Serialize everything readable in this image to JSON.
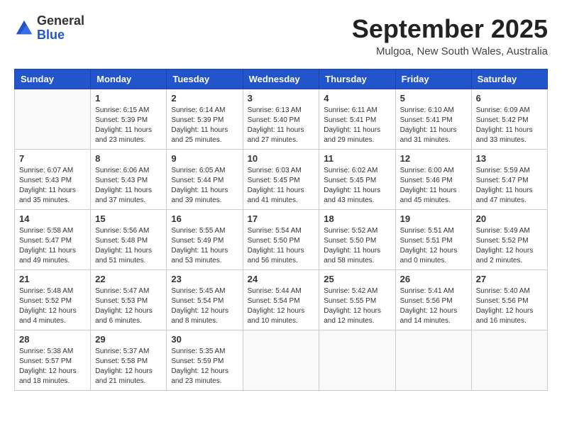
{
  "logo": {
    "general": "General",
    "blue": "Blue"
  },
  "title": "September 2025",
  "subtitle": "Mulgoa, New South Wales, Australia",
  "days": [
    "Sunday",
    "Monday",
    "Tuesday",
    "Wednesday",
    "Thursday",
    "Friday",
    "Saturday"
  ],
  "weeks": [
    [
      {
        "day": "",
        "content": ""
      },
      {
        "day": "1",
        "content": "Sunrise: 6:15 AM\nSunset: 5:39 PM\nDaylight: 11 hours\nand 23 minutes."
      },
      {
        "day": "2",
        "content": "Sunrise: 6:14 AM\nSunset: 5:39 PM\nDaylight: 11 hours\nand 25 minutes."
      },
      {
        "day": "3",
        "content": "Sunrise: 6:13 AM\nSunset: 5:40 PM\nDaylight: 11 hours\nand 27 minutes."
      },
      {
        "day": "4",
        "content": "Sunrise: 6:11 AM\nSunset: 5:41 PM\nDaylight: 11 hours\nand 29 minutes."
      },
      {
        "day": "5",
        "content": "Sunrise: 6:10 AM\nSunset: 5:41 PM\nDaylight: 11 hours\nand 31 minutes."
      },
      {
        "day": "6",
        "content": "Sunrise: 6:09 AM\nSunset: 5:42 PM\nDaylight: 11 hours\nand 33 minutes."
      }
    ],
    [
      {
        "day": "7",
        "content": "Sunrise: 6:07 AM\nSunset: 5:43 PM\nDaylight: 11 hours\nand 35 minutes."
      },
      {
        "day": "8",
        "content": "Sunrise: 6:06 AM\nSunset: 5:43 PM\nDaylight: 11 hours\nand 37 minutes."
      },
      {
        "day": "9",
        "content": "Sunrise: 6:05 AM\nSunset: 5:44 PM\nDaylight: 11 hours\nand 39 minutes."
      },
      {
        "day": "10",
        "content": "Sunrise: 6:03 AM\nSunset: 5:45 PM\nDaylight: 11 hours\nand 41 minutes."
      },
      {
        "day": "11",
        "content": "Sunrise: 6:02 AM\nSunset: 5:45 PM\nDaylight: 11 hours\nand 43 minutes."
      },
      {
        "day": "12",
        "content": "Sunrise: 6:00 AM\nSunset: 5:46 PM\nDaylight: 11 hours\nand 45 minutes."
      },
      {
        "day": "13",
        "content": "Sunrise: 5:59 AM\nSunset: 5:47 PM\nDaylight: 11 hours\nand 47 minutes."
      }
    ],
    [
      {
        "day": "14",
        "content": "Sunrise: 5:58 AM\nSunset: 5:47 PM\nDaylight: 11 hours\nand 49 minutes."
      },
      {
        "day": "15",
        "content": "Sunrise: 5:56 AM\nSunset: 5:48 PM\nDaylight: 11 hours\nand 51 minutes."
      },
      {
        "day": "16",
        "content": "Sunrise: 5:55 AM\nSunset: 5:49 PM\nDaylight: 11 hours\nand 53 minutes."
      },
      {
        "day": "17",
        "content": "Sunrise: 5:54 AM\nSunset: 5:50 PM\nDaylight: 11 hours\nand 56 minutes."
      },
      {
        "day": "18",
        "content": "Sunrise: 5:52 AM\nSunset: 5:50 PM\nDaylight: 11 hours\nand 58 minutes."
      },
      {
        "day": "19",
        "content": "Sunrise: 5:51 AM\nSunset: 5:51 PM\nDaylight: 12 hours\nand 0 minutes."
      },
      {
        "day": "20",
        "content": "Sunrise: 5:49 AM\nSunset: 5:52 PM\nDaylight: 12 hours\nand 2 minutes."
      }
    ],
    [
      {
        "day": "21",
        "content": "Sunrise: 5:48 AM\nSunset: 5:52 PM\nDaylight: 12 hours\nand 4 minutes."
      },
      {
        "day": "22",
        "content": "Sunrise: 5:47 AM\nSunset: 5:53 PM\nDaylight: 12 hours\nand 6 minutes."
      },
      {
        "day": "23",
        "content": "Sunrise: 5:45 AM\nSunset: 5:54 PM\nDaylight: 12 hours\nand 8 minutes."
      },
      {
        "day": "24",
        "content": "Sunrise: 5:44 AM\nSunset: 5:54 PM\nDaylight: 12 hours\nand 10 minutes."
      },
      {
        "day": "25",
        "content": "Sunrise: 5:42 AM\nSunset: 5:55 PM\nDaylight: 12 hours\nand 12 minutes."
      },
      {
        "day": "26",
        "content": "Sunrise: 5:41 AM\nSunset: 5:56 PM\nDaylight: 12 hours\nand 14 minutes."
      },
      {
        "day": "27",
        "content": "Sunrise: 5:40 AM\nSunset: 5:56 PM\nDaylight: 12 hours\nand 16 minutes."
      }
    ],
    [
      {
        "day": "28",
        "content": "Sunrise: 5:38 AM\nSunset: 5:57 PM\nDaylight: 12 hours\nand 18 minutes."
      },
      {
        "day": "29",
        "content": "Sunrise: 5:37 AM\nSunset: 5:58 PM\nDaylight: 12 hours\nand 21 minutes."
      },
      {
        "day": "30",
        "content": "Sunrise: 5:35 AM\nSunset: 5:59 PM\nDaylight: 12 hours\nand 23 minutes."
      },
      {
        "day": "",
        "content": ""
      },
      {
        "day": "",
        "content": ""
      },
      {
        "day": "",
        "content": ""
      },
      {
        "day": "",
        "content": ""
      }
    ]
  ]
}
